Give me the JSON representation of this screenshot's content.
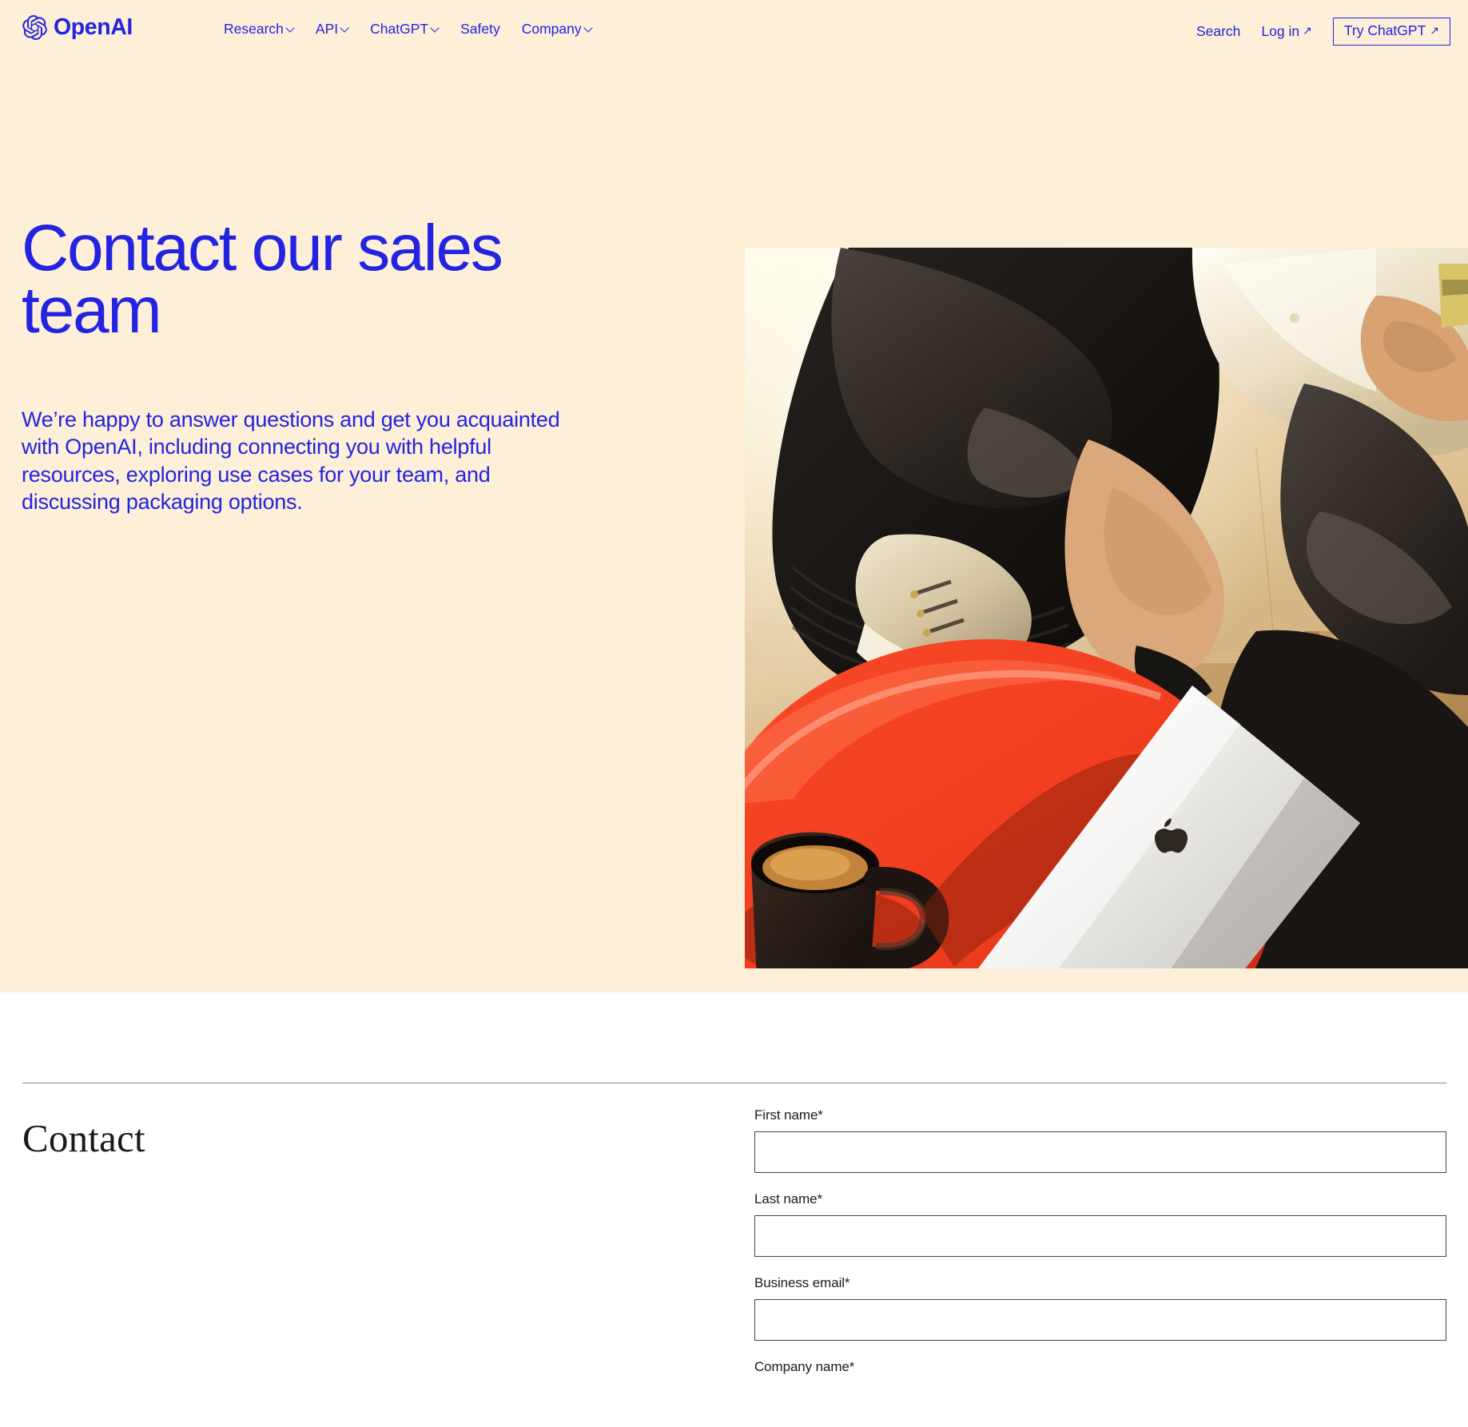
{
  "colors": {
    "cream_bg": "#FDEFD8",
    "brand_blue": "#2323E0",
    "white_bg": "#FFFFFF",
    "divider": "#8C8C8C",
    "text_dark": "#1B1B1B"
  },
  "nav": {
    "brand": "OpenAI",
    "center_items": [
      {
        "label": "Research",
        "has_dropdown": true
      },
      {
        "label": "API",
        "has_dropdown": true
      },
      {
        "label": "ChatGPT",
        "has_dropdown": true
      },
      {
        "label": "Safety",
        "has_dropdown": false
      },
      {
        "label": "Company",
        "has_dropdown": true
      }
    ],
    "search_label": "Search",
    "login_label": "Log in",
    "login_arrow": "↗",
    "cta_label": "Try ChatGPT",
    "cta_arrow": "↗"
  },
  "hero": {
    "title": "Contact our sales team",
    "subtitle": "We’re happy to answer questions and get you acquainted with OpenAI, including connecting you with helpful resources, exploring use cases for your team, and discussing packaging options.",
    "image_alt": "Person seated in a dark chair with crossed legs wearing green and tan sneakers, beside a round red table holding a silver MacBook laptop and a dark coffee mug on a light wood floor"
  },
  "contact": {
    "heading": "Contact",
    "fields": [
      {
        "label": "First name*",
        "value": "",
        "placeholder": "",
        "type": "text",
        "name": "first-name"
      },
      {
        "label": "Last name*",
        "value": "",
        "placeholder": "",
        "type": "text",
        "name": "last-name"
      },
      {
        "label": "Business email*",
        "value": "",
        "placeholder": "",
        "type": "email",
        "name": "business-email"
      },
      {
        "label": "Company name*",
        "value": "",
        "placeholder": "",
        "type": "text",
        "name": "company-name"
      }
    ]
  }
}
